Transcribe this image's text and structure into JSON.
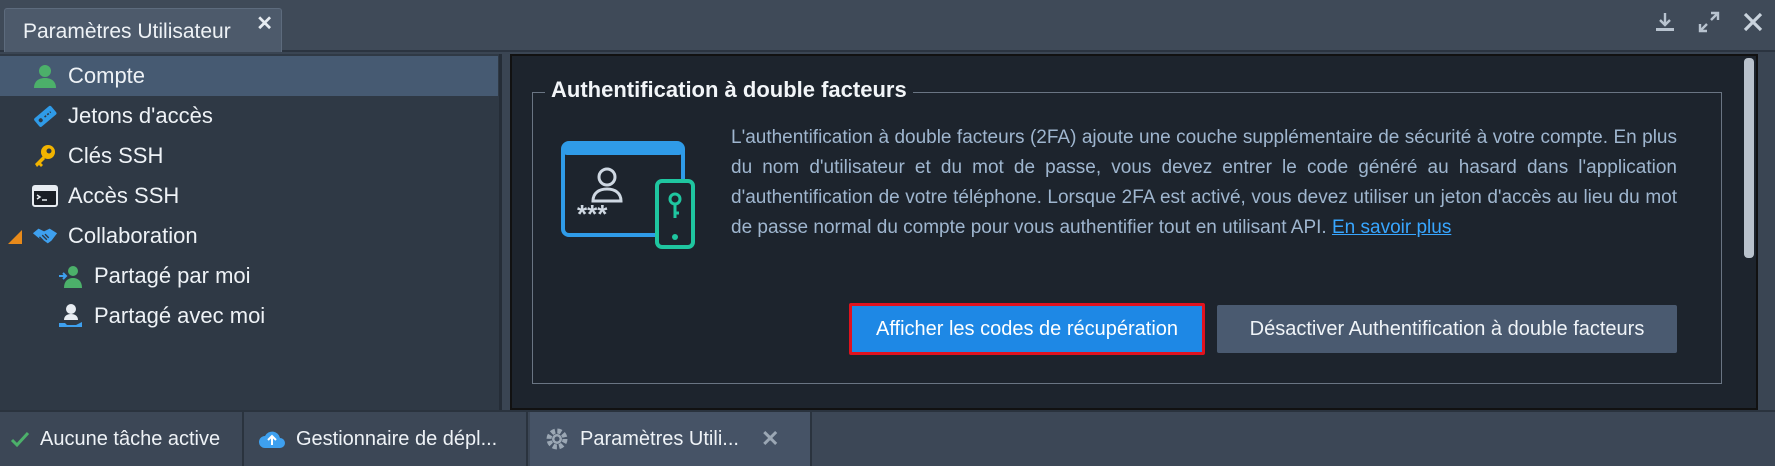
{
  "window": {
    "tab_title": "Paramètres Utilisateur",
    "close_glyph": "✕"
  },
  "sidebar": {
    "items": [
      {
        "label": "Compte",
        "icon": "user-icon"
      },
      {
        "label": "Jetons d'accès",
        "icon": "token-icon"
      },
      {
        "label": "Clés SSH",
        "icon": "key-icon"
      },
      {
        "label": "Accès SSH",
        "icon": "terminal-icon"
      },
      {
        "label": "Collaboration",
        "icon": "handshake-icon"
      },
      {
        "label": "Partagé par moi",
        "icon": "shared-user-icon"
      },
      {
        "label": "Partagé avec moi",
        "icon": "received-user-icon"
      }
    ]
  },
  "main": {
    "section_title": "Authentification à double facteurs",
    "description": "L'authentification à double facteurs (2FA) ajoute une couche supplémentaire de sécurité à votre compte. En plus du nom d'utilisateur et du mot de passe, vous devez entrer le code généré au hasard dans l'application d'authentification de votre téléphone. Lorsque 2FA est activé, vous devez utiliser un jeton d'accès au lieu du mot de passe normal du compte pour vous authentifier tout en utilisant API.",
    "learn_more": "En savoir plus",
    "illustration_text": "***",
    "show_codes_button": "Afficher les codes de récupération",
    "disable_button": "Désactiver Authentification à double facteurs"
  },
  "taskbar": {
    "status": "Aucune tâche active",
    "tasks": [
      {
        "label": "Gestionnaire de dépl..."
      },
      {
        "label": "Paramètres Utili..."
      }
    ],
    "close_glyph": "✕"
  },
  "colors": {
    "accent": "#1e88e5",
    "highlight_border": "#e0121e",
    "selected_row": "#465a72",
    "link": "#38a6ff"
  }
}
